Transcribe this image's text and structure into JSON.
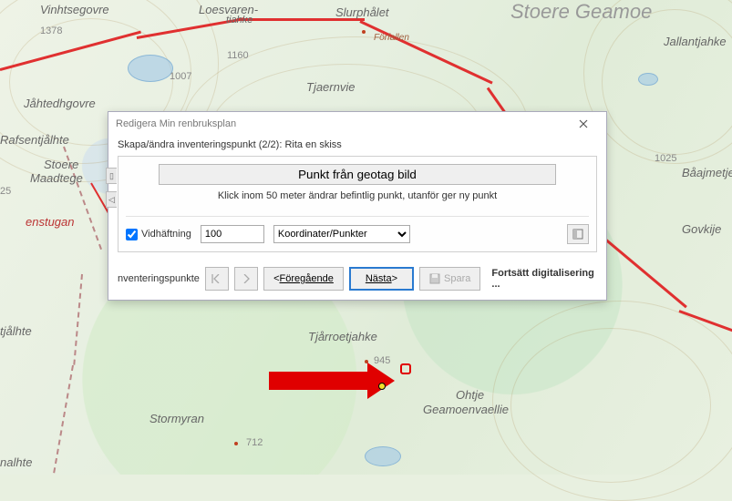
{
  "map": {
    "labels": {
      "slurphalet": "Slurphålet",
      "vinhtsegovre": "Vinhtsegovre",
      "loesvaren": "Loesvaren-",
      "tiahke": "tiahke",
      "tjaernvie": "Tjaernvie",
      "jahtedhgovre": "Jåhtedhgovre",
      "rafsentjalhte": "Rafsentjålhte",
      "stoere": "Stoere",
      "maadtege": "Maadtege",
      "enstugan": "enstugan",
      "tjalhte": "tjålhte",
      "tjarroetjahke": "Tjårroetjahke",
      "stormyran": "Stormyran",
      "ohtje": "Ohtje",
      "geamoenvaellie": "Geamoenvaellie",
      "nalhte": "nalhte",
      "jallantjahke": "Jallantjahke",
      "baajmetje": "Båajmetje",
      "govkije": "Govkije",
      "forfallen": "Förfallen",
      "stoereGeamoe": "Stoere Geamoe"
    },
    "elev": {
      "e1378": "1378",
      "e1160": "1160",
      "e1007": "1007",
      "e25": "25",
      "e945": "945",
      "e712": "712",
      "e1025": "1025"
    }
  },
  "dialog": {
    "title": "Redigera Min renbruksplan",
    "subtitle": "Skapa/ändra inventeringspunkt (2/2): Rita en skiss",
    "wideButton": "Punkt från geotag bild",
    "hint": "Klick inom 50 meter ändrar befintlig punkt, utanför ger ny punkt",
    "vidhaftning_label": "Vidhäftning",
    "vidhaftning_value": "100",
    "dropdown_value": "Koordinater/Punkter",
    "inventeringspunkte": "nventeringspunkte",
    "prev": "Föregående",
    "next": "Nästa",
    "save": "Spara",
    "continue": "Fortsätt digitalisering ..."
  }
}
